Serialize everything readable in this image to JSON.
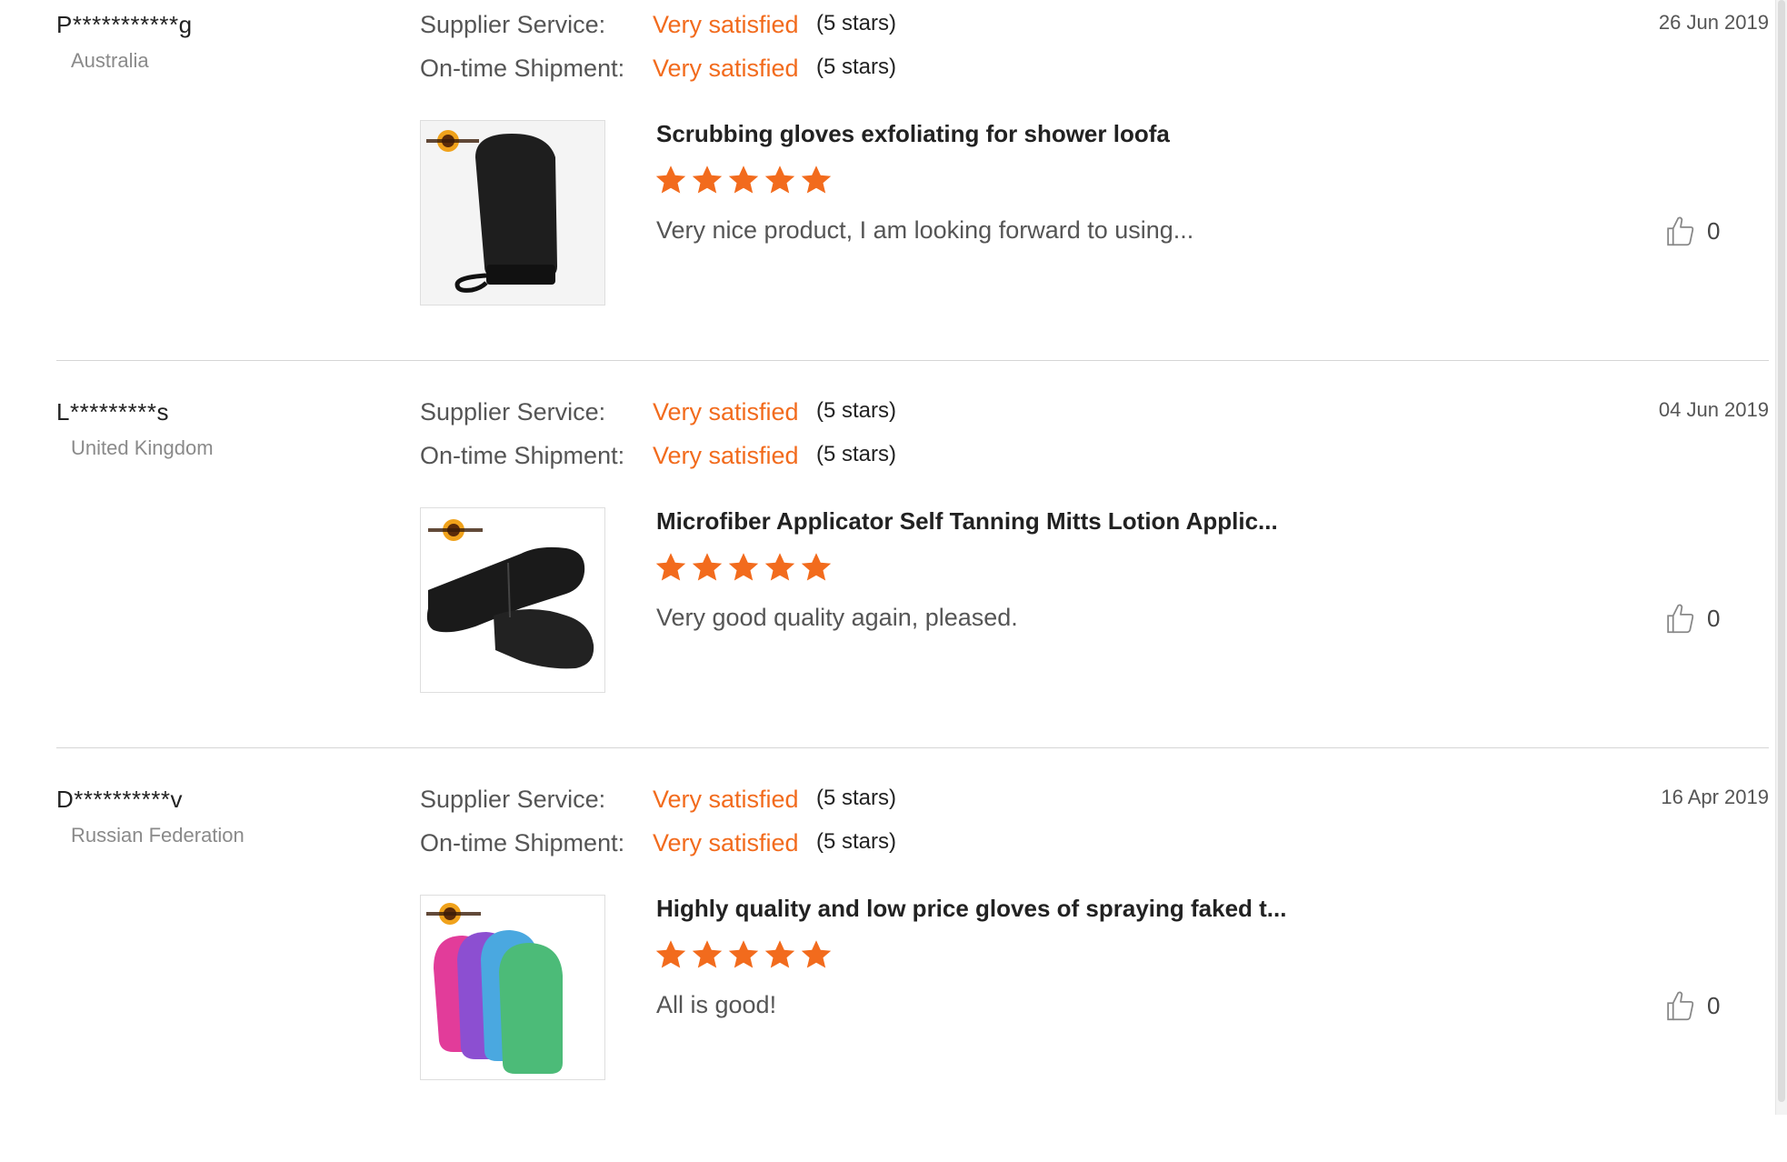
{
  "labels": {
    "supplier_service": "Supplier Service:",
    "on_time_shipment": "On-time Shipment:"
  },
  "colors": {
    "accent": "#f26b1d",
    "star": "#f26b1d",
    "divider": "#d6d6d6"
  },
  "reviews": [
    {
      "user": "P***********g",
      "country": "Australia",
      "date": "26 Jun 2019",
      "supplier_service": {
        "value": "Very satisfied",
        "stars": "(5 stars)"
      },
      "on_time_shipment": {
        "value": "Very satisfied",
        "stars": "(5 stars)"
      },
      "product_title": "Scrubbing gloves exfoliating for shower loofa",
      "rating": 5,
      "comment": "Very nice product, I am looking forward to using...",
      "likes": "0",
      "thumbnail_icon": "black-exfoliating-glove-image"
    },
    {
      "user": "L*********s",
      "country": "United Kingdom",
      "date": "04 Jun 2019",
      "supplier_service": {
        "value": "Very satisfied",
        "stars": "(5 stars)"
      },
      "on_time_shipment": {
        "value": "Very satisfied",
        "stars": "(5 stars)"
      },
      "product_title": "Microfiber Applicator Self Tanning Mitts Lotion Applic...",
      "rating": 5,
      "comment": "Very good quality again, pleased.",
      "likes": "0",
      "thumbnail_icon": "black-back-applicator-strap-image"
    },
    {
      "user": "D**********v",
      "country": "Russian Federation",
      "date": "16 Apr 2019",
      "supplier_service": {
        "value": "Very satisfied",
        "stars": "(5 stars)"
      },
      "on_time_shipment": {
        "value": "Very satisfied",
        "stars": "(5 stars)"
      },
      "product_title": "Highly quality and low price gloves of spraying faked t...",
      "rating": 5,
      "comment": "All is good!",
      "likes": "0",
      "thumbnail_icon": "colorful-tanning-mitts-image"
    }
  ]
}
